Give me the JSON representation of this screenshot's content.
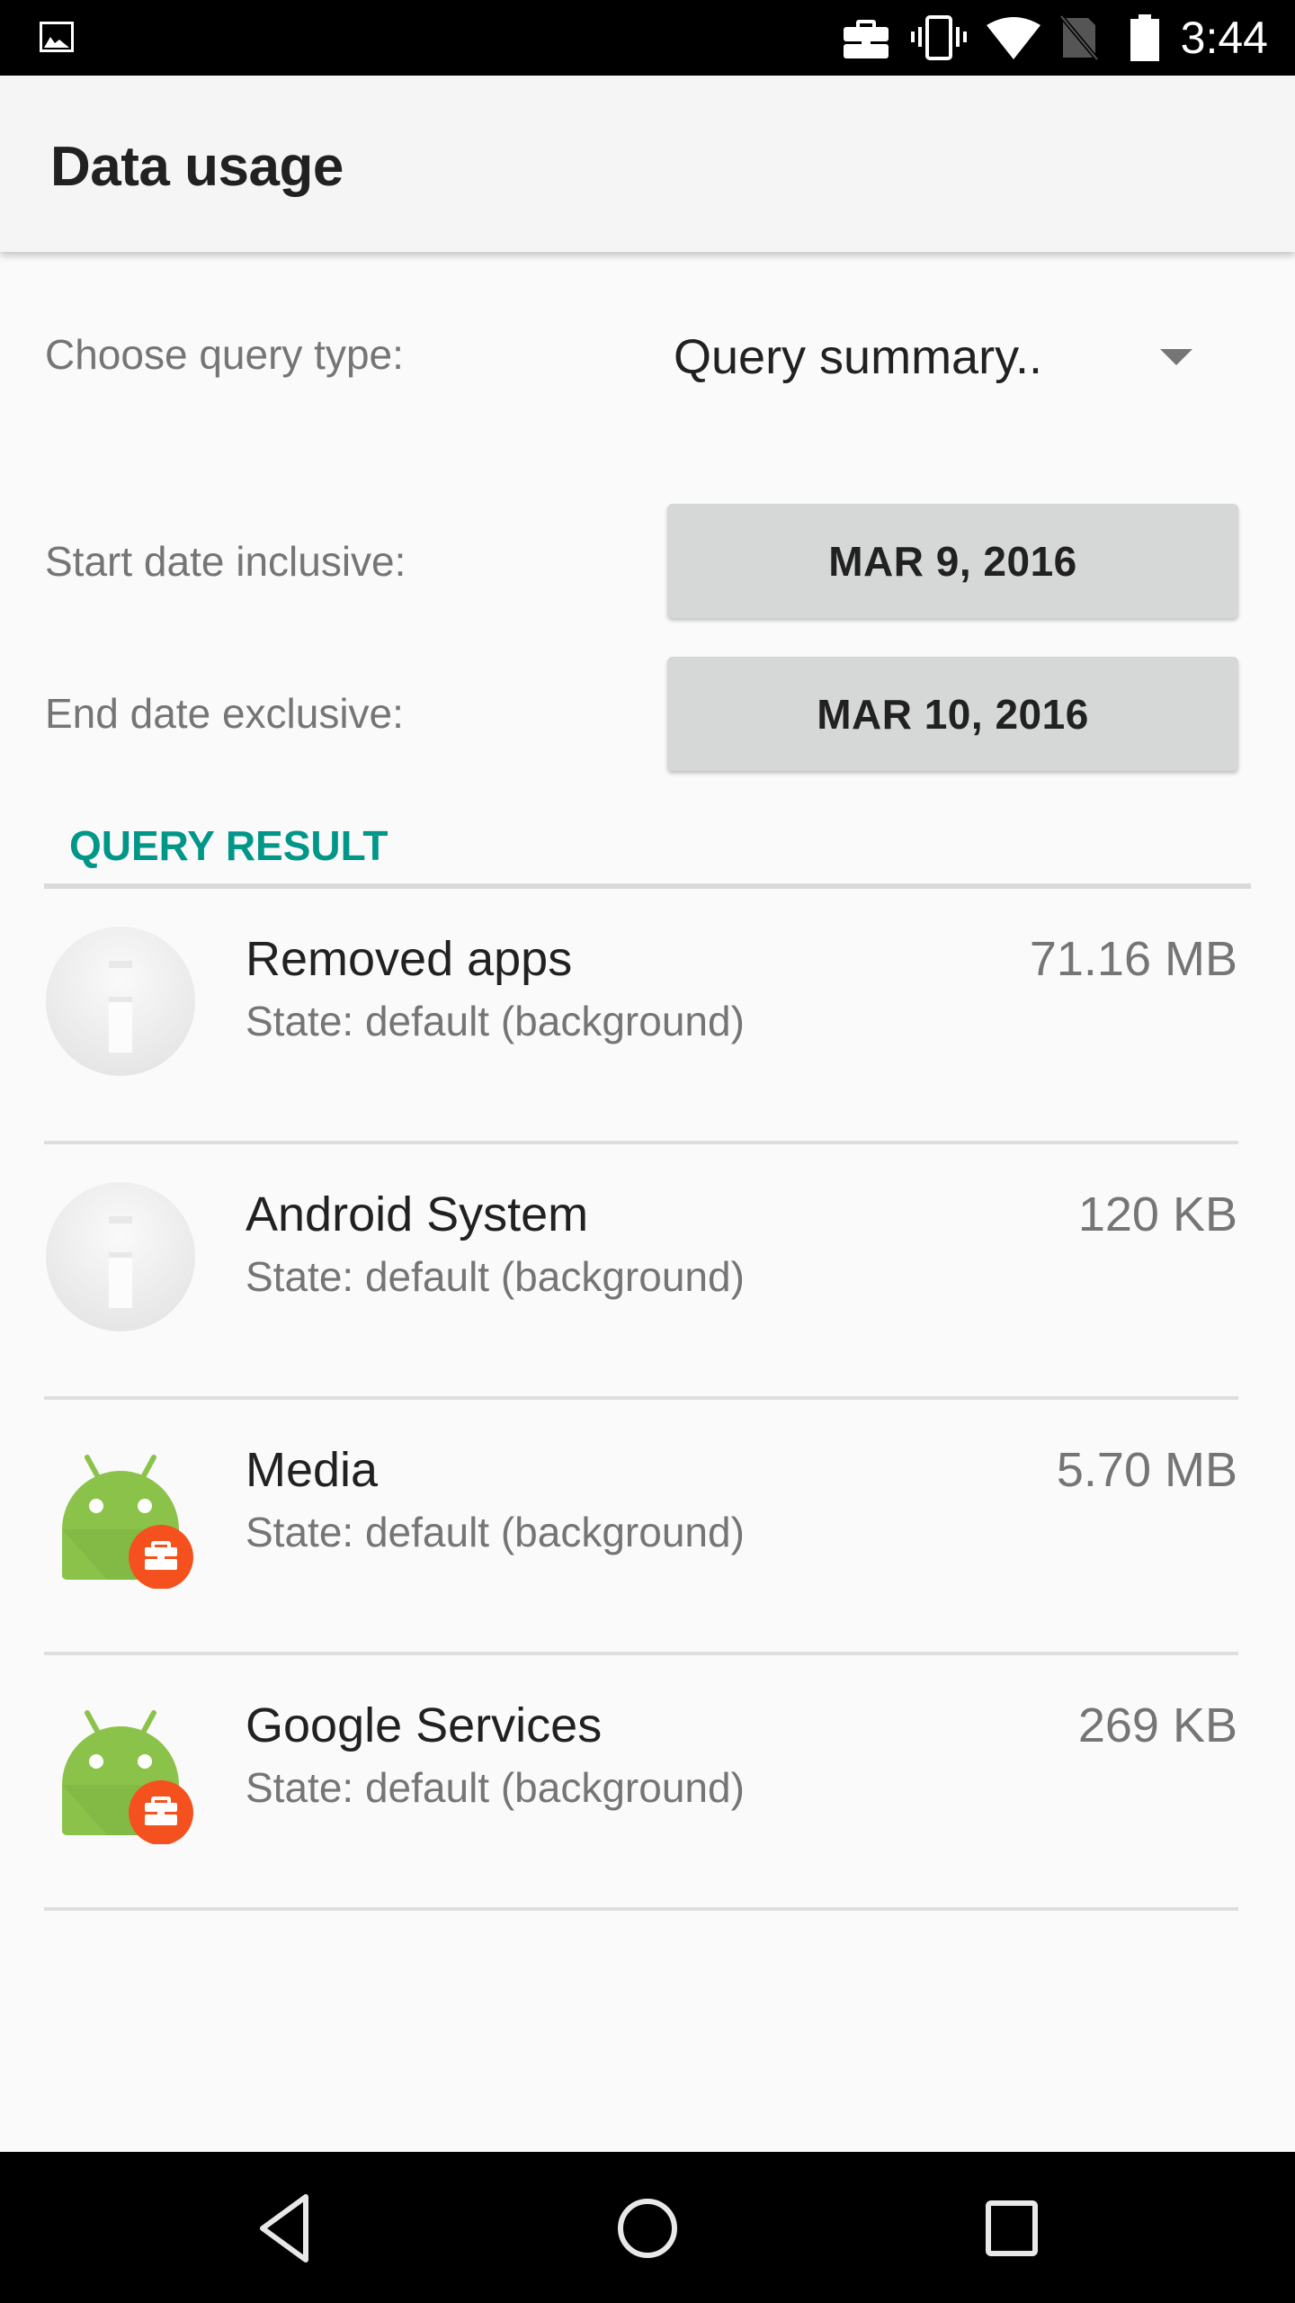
{
  "status_bar": {
    "time": "3:44",
    "left_icons": [
      "gallery-notification-icon"
    ],
    "right_icons": [
      "work-briefcase-icon",
      "vibrate-icon",
      "wifi-icon",
      "no-sim-icon",
      "battery-icon"
    ]
  },
  "toolbar": {
    "title": "Data usage"
  },
  "form": {
    "query_type_label": "Choose query type:",
    "query_type_value": "Query summary..",
    "start_date_label": "Start date inclusive:",
    "start_date_value": "MAR 9, 2016",
    "end_date_label": "End date exclusive:",
    "end_date_value": "MAR 10, 2016"
  },
  "results": {
    "header": "QUERY RESULT",
    "accent_color": "#009688",
    "items": [
      {
        "name": "Removed apps",
        "state": "State: default (background)",
        "usage": "71.16 MB",
        "icon": "info-circle-icon"
      },
      {
        "name": "Android System",
        "state": "State: default (background)",
        "usage": "120 KB",
        "icon": "info-circle-icon"
      },
      {
        "name": "Media",
        "state": "State: default (background)",
        "usage": "5.70 MB",
        "icon": "android-work-app-icon"
      },
      {
        "name": "Google Services",
        "state": "State: default (background)",
        "usage": "269 KB",
        "icon": "android-work-app-icon"
      }
    ]
  },
  "nav_bar": {
    "buttons": [
      "back",
      "home",
      "recents"
    ]
  }
}
